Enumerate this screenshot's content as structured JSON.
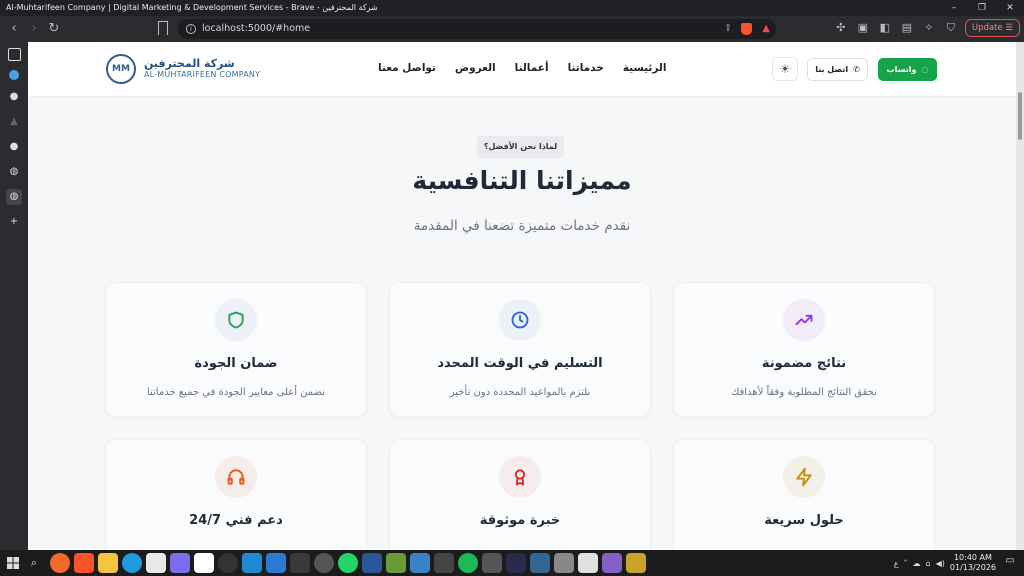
{
  "window": {
    "title": "Al-Muhtarifeen Company | Digital Marketing & Development Services - Brave - شركة المحترفين",
    "controls": [
      "–",
      "❐",
      "✕"
    ]
  },
  "browser": {
    "url": "localhost:5000/#home",
    "update_label": "Update"
  },
  "header": {
    "logo_ar": "شركة المحترفين",
    "logo_en": "AL-MUHTARIFEEN COMPANY",
    "logo_badge": "MM",
    "nav": [
      "الرئيسية",
      "خدماتنا",
      "أعمالنا",
      "العروض",
      "تواصل معنا"
    ],
    "call_label": "اتصل بنا",
    "whatsapp_label": "واتساب"
  },
  "hero": {
    "pill": "لماذا نحن الأفضل؟",
    "title": "مميزاتنا التنافسية",
    "subtitle": "نقدم خدمات متميزة تضعنا في المقدمة"
  },
  "cards": [
    {
      "title": "ضمان الجودة",
      "desc": "نضمن أعلى معايير الجودة في جميع خدماتنا",
      "icon": "shield-icon",
      "color": "#16a34a",
      "bg": "#eef0f7"
    },
    {
      "title": "التسليم في الوقت المحدد",
      "desc": "نلتزم بالمواعيد المحددة دون تأخير",
      "icon": "clock-icon",
      "color": "#2563eb",
      "bg": "#eef0f7"
    },
    {
      "title": "نتائج مضمونة",
      "desc": "نحقق النتائج المطلوبة وفقاً لأهدافك",
      "icon": "trending-up-icon",
      "color": "#9333ea",
      "bg": "#f1ecf8"
    },
    {
      "title": "دعم فني 24/7",
      "desc": "",
      "icon": "headphones-icon",
      "color": "#ea580c",
      "bg": "#f6ecea"
    },
    {
      "title": "خبرة موثوقة",
      "desc": "",
      "icon": "award-icon",
      "color": "#dc2626",
      "bg": "#f6ecee"
    },
    {
      "title": "حلول سريعة",
      "desc": "",
      "icon": "lightning-icon",
      "color": "#ca8a04",
      "bg": "#f3f0e8"
    }
  ],
  "taskbar": {
    "time": "10:40 AM",
    "date": "01/13/2026",
    "lang": "ع"
  }
}
